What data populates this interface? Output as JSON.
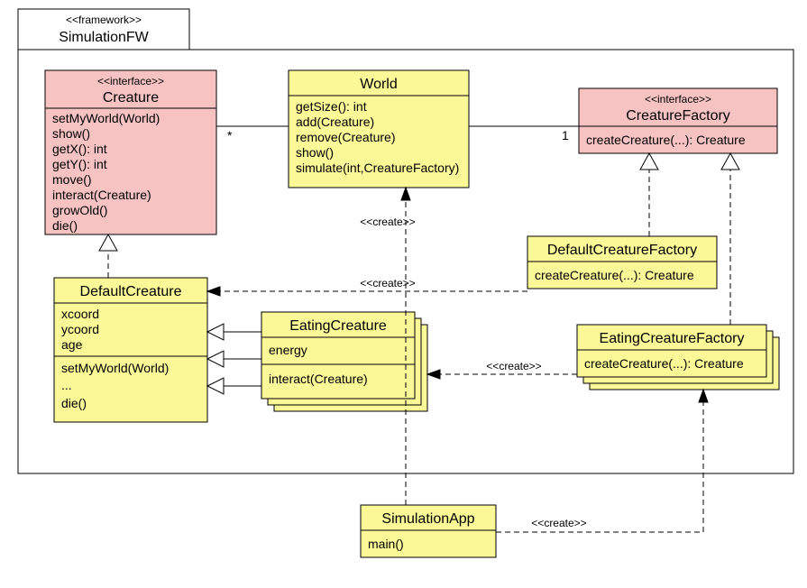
{
  "package": {
    "stereotype": "<<framework>>",
    "name": "SimulationFW"
  },
  "creature": {
    "stereotype": "<<interface>>",
    "name": "Creature",
    "ops": [
      "setMyWorld(World)",
      "show()",
      "getX(): int",
      "getY(): int",
      "move()",
      "interact(Creature)",
      "growOld()",
      "die()"
    ]
  },
  "world": {
    "name": "World",
    "ops": [
      "getSize(): int",
      "add(Creature)",
      "remove(Creature)",
      "show()",
      "simulate(int,CreatureFactory)"
    ]
  },
  "creatureFactory": {
    "stereotype": "<<interface>>",
    "name": "CreatureFactory",
    "ops": [
      "createCreature(...): Creature"
    ]
  },
  "defaultCreature": {
    "name": "DefaultCreature",
    "attrs": [
      "xcoord",
      "ycoord",
      "age"
    ],
    "ops": [
      "setMyWorld(World)",
      "...",
      "die()"
    ]
  },
  "eatingCreature": {
    "name": "EatingCreature",
    "attrs": [
      "energy"
    ],
    "ops": [
      "interact(Creature)"
    ]
  },
  "defaultCreatureFactory": {
    "name": "DefaultCreatureFactory",
    "ops": [
      "createCreature(...): Creature"
    ]
  },
  "eatingCreatureFactory": {
    "name": "EatingCreatureFactory",
    "ops": [
      "createCreature(...): Creature"
    ]
  },
  "simulationApp": {
    "name": "SimulationApp",
    "ops": [
      "main()"
    ]
  },
  "labels": {
    "create": "<<create>>",
    "star": "*",
    "one": "1"
  },
  "chart_data": {
    "type": "uml-class-diagram",
    "package": {
      "name": "SimulationFW",
      "stereotype": "framework"
    },
    "classes": [
      {
        "name": "Creature",
        "stereotype": "interface",
        "operations": [
          "setMyWorld(World)",
          "show()",
          "getX(): int",
          "getY(): int",
          "move()",
          "interact(Creature)",
          "growOld()",
          "die()"
        ]
      },
      {
        "name": "World",
        "operations": [
          "getSize(): int",
          "add(Creature)",
          "remove(Creature)",
          "show()",
          "simulate(int,CreatureFactory)"
        ]
      },
      {
        "name": "CreatureFactory",
        "stereotype": "interface",
        "operations": [
          "createCreature(...): Creature"
        ]
      },
      {
        "name": "DefaultCreature",
        "attributes": [
          "xcoord",
          "ycoord",
          "age"
        ],
        "operations": [
          "setMyWorld(World)",
          "...",
          "die()"
        ]
      },
      {
        "name": "EatingCreature",
        "attributes": [
          "energy"
        ],
        "operations": [
          "interact(Creature)"
        ]
      },
      {
        "name": "DefaultCreatureFactory",
        "operations": [
          "createCreature(...): Creature"
        ]
      },
      {
        "name": "EatingCreatureFactory",
        "operations": [
          "createCreature(...): Creature"
        ]
      },
      {
        "name": "SimulationApp",
        "operations": [
          "main()"
        ]
      }
    ],
    "relationships": [
      {
        "type": "association",
        "from": "World",
        "to": "Creature",
        "from_multiplicity": "",
        "to_multiplicity": "*"
      },
      {
        "type": "association",
        "from": "World",
        "to": "CreatureFactory",
        "from_multiplicity": "",
        "to_multiplicity": "1"
      },
      {
        "type": "realization",
        "from": "DefaultCreature",
        "to": "Creature"
      },
      {
        "type": "generalization",
        "from": "EatingCreature",
        "to": "DefaultCreature"
      },
      {
        "type": "realization",
        "from": "DefaultCreatureFactory",
        "to": "CreatureFactory"
      },
      {
        "type": "realization",
        "from": "EatingCreatureFactory",
        "to": "CreatureFactory"
      },
      {
        "type": "dependency",
        "stereotype": "create",
        "from": "DefaultCreatureFactory",
        "to": "DefaultCreature"
      },
      {
        "type": "dependency",
        "stereotype": "create",
        "from": "EatingCreatureFactory",
        "to": "EatingCreature"
      },
      {
        "type": "dependency",
        "stereotype": "create",
        "from": "SimulationApp",
        "to": "World"
      },
      {
        "type": "dependency",
        "stereotype": "create",
        "from": "SimulationApp",
        "to": "EatingCreatureFactory"
      }
    ]
  }
}
